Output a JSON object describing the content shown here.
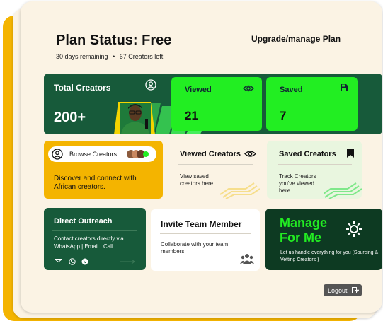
{
  "header": {
    "title": "Plan Status: Free",
    "days_remaining": "30 days remaining",
    "separator": "•",
    "creators_left": "67 Creators left",
    "upgrade_label": "Upgrade/manage Plan"
  },
  "stats": {
    "total_label": "Total Creators",
    "total_value": "200+",
    "viewed_label": "Viewed",
    "viewed_value": "21",
    "saved_label": "Saved",
    "saved_value": "7"
  },
  "browse": {
    "button_label": "Browse Creators",
    "description": "Discover and connect with African creators."
  },
  "viewed_creators": {
    "title": "Viewed Creators",
    "description": "View saved creators here"
  },
  "saved_creators": {
    "title": "Saved Creators",
    "description": "Track Creators you've viewed here"
  },
  "outreach": {
    "title": "Direct Outreach",
    "description": "Contact creators directly via WhatsApp | Email | Call"
  },
  "invite": {
    "title": "Invite Team Member",
    "description": "Collaborate with your team members"
  },
  "manage": {
    "title": "Manage For Me",
    "description": "Let us handle everything for you (Sourcing & Vetting Creators )"
  },
  "logout_label": "Logout",
  "colors": {
    "brand_green": "#175A3A",
    "neon_green": "#22EE22",
    "yellow": "#F4B400",
    "dark_green": "#0D3A22",
    "cream": "#FBF3E4"
  },
  "icons": [
    "person-circle-icon",
    "eye-icon",
    "save-icon",
    "bookmark-icon",
    "mail-icon",
    "phone-icon",
    "whatsapp-icon",
    "arrow-right-icon",
    "team-icon",
    "gear-icon",
    "logout-icon"
  ]
}
